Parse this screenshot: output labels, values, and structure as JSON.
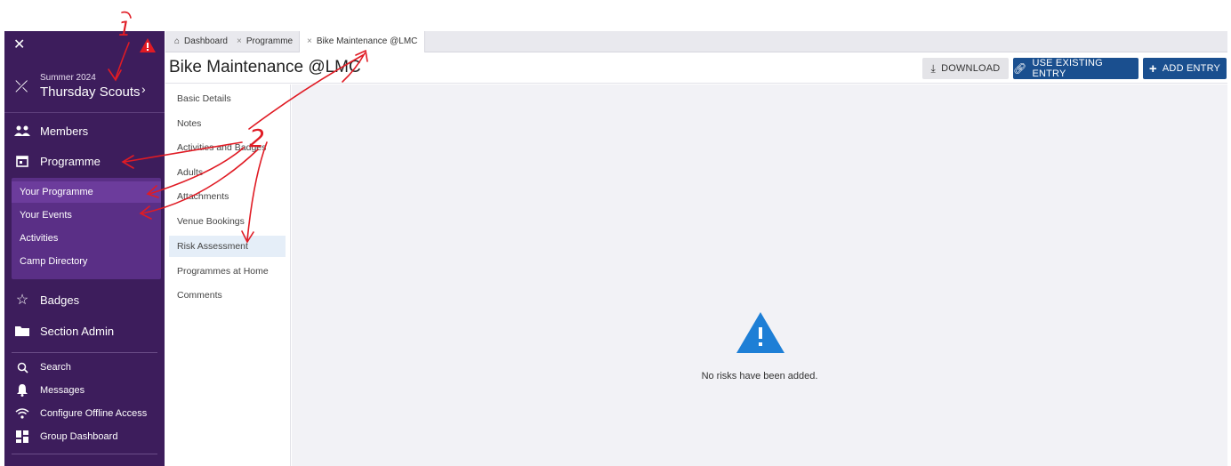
{
  "sidebar": {
    "section": {
      "term": "Summer 2024",
      "name": "Thursday Scouts"
    },
    "nav": [
      {
        "label": "Members"
      },
      {
        "label": "Programme"
      },
      {
        "label": "Badges"
      },
      {
        "label": "Section Admin"
      }
    ],
    "submenu": [
      {
        "label": "Your Programme"
      },
      {
        "label": "Your Events"
      },
      {
        "label": "Activities"
      },
      {
        "label": "Camp Directory"
      }
    ],
    "utility": [
      {
        "label": "Search"
      },
      {
        "label": "Messages"
      },
      {
        "label": "Configure Offline Access"
      },
      {
        "label": "Group Dashboard"
      }
    ]
  },
  "tabs": [
    {
      "label": "Dashboard"
    },
    {
      "label": "Programme"
    },
    {
      "label": "Bike Maintenance @LMC"
    }
  ],
  "header": {
    "title": "Bike Maintenance @LMC",
    "download_label": "DOWNLOAD",
    "use_existing_label": "USE EXISTING ENTRY",
    "add_entry_label": "ADD ENTRY"
  },
  "subnav": [
    {
      "label": "Basic Details"
    },
    {
      "label": "Notes"
    },
    {
      "label": "Activities and Badges"
    },
    {
      "label": "Adults"
    },
    {
      "label": "Attachments"
    },
    {
      "label": "Venue Bookings"
    },
    {
      "label": "Risk Assessment"
    },
    {
      "label": "Programmes at Home"
    },
    {
      "label": "Comments"
    }
  ],
  "main": {
    "empty_message": "No risks have been added."
  },
  "annotations": {
    "one": "1",
    "two": "2"
  },
  "colors": {
    "sidebar": "#3d1d5c",
    "submenu": "#5a2f86",
    "primary_button": "#1a4f8f",
    "warning": "#e01b24",
    "empty_icon": "#1e7fd6",
    "annotation": "#e01b24"
  }
}
